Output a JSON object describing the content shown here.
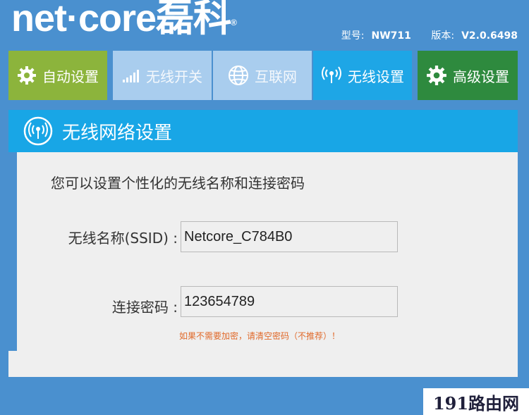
{
  "brand": {
    "logo_text": "net·core",
    "logo_cn": "磊科",
    "registered": "®"
  },
  "model": {
    "model_label": "型号:",
    "model_value": "NW711",
    "version_label": "版本:",
    "version_value": "V2.0.6498"
  },
  "nav": {
    "tabs": [
      {
        "label": "自动设置",
        "icon": "gear-icon"
      },
      {
        "label": "无线开关",
        "icon": "signal-bars-icon"
      },
      {
        "label": "互联网",
        "icon": "globe-icon"
      },
      {
        "label": "无线设置",
        "icon": "wifi-antenna-icon"
      },
      {
        "label": "高级设置",
        "icon": "gear-icon"
      }
    ],
    "active_index": 3
  },
  "panel": {
    "title": "无线网络设置",
    "intro": "您可以设置个性化的无线名称和连接密码",
    "ssid_label": "无线名称(SSID) :",
    "ssid_value": "Netcore_C784B0",
    "password_label": "连接密码 :",
    "password_value": "123654789",
    "hint": "如果不需要加密，请清空密码（不推荐）！"
  },
  "watermark": "191路由网",
  "colors": {
    "background": "#4a90cf",
    "auto_tab": "#8cb43c",
    "inactive_tab": "#a9cdee",
    "active_tab": "#1ea6e6",
    "advanced_tab": "#2e8a3e",
    "header": "#18a6e6",
    "hint": "#e0692a"
  }
}
